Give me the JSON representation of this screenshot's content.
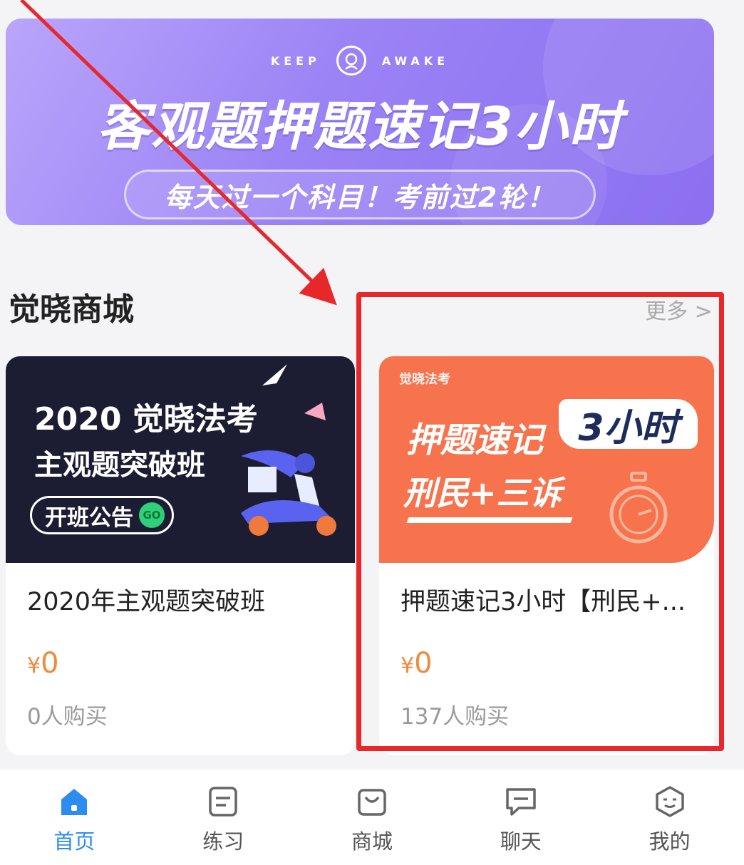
{
  "banner": {
    "brand_left": "KEEP",
    "brand_right": "AWAKE",
    "title": "客观题押题速记3小时",
    "subtitle": "每天过一个科目！考前过2轮！"
  },
  "section": {
    "title": "觉晓商城",
    "more_label": "更多 >"
  },
  "products": [
    {
      "image_title": "2020 觉晓法考",
      "image_subtitle": "主观题突破班",
      "image_button": "开班公告",
      "image_go": "GO",
      "name": "2020年主观题突破班",
      "currency": "¥",
      "price": "0",
      "buyers": "0人购买"
    },
    {
      "image_brand": "觉晓法考",
      "image_title": "押题速记",
      "image_hours": "3小时",
      "image_subtitle": "刑民+三诉",
      "name": "押题速记3小时【刑民+...",
      "currency": "¥",
      "price": "0",
      "buyers": "137人购买"
    }
  ],
  "tabbar": [
    {
      "label": "首页",
      "icon": "home-icon",
      "active": true
    },
    {
      "label": "练习",
      "icon": "practice-icon",
      "active": false
    },
    {
      "label": "商城",
      "icon": "shop-bag-icon",
      "active": false
    },
    {
      "label": "聊天",
      "icon": "chat-icon",
      "active": false
    },
    {
      "label": "我的",
      "icon": "profile-icon",
      "active": false
    }
  ],
  "colors": {
    "accent": "#2d8cf0",
    "price": "#f08a3c",
    "highlight": "#e8272a"
  }
}
